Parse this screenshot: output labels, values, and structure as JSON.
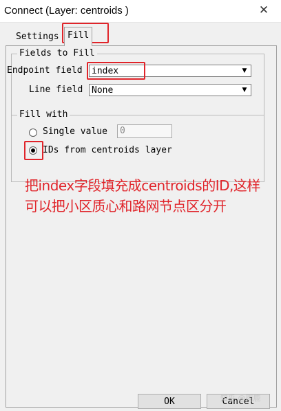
{
  "window": {
    "title": "Connect (Layer: centroids )",
    "close_glyph": "✕"
  },
  "tabs": [
    {
      "label": "Settings"
    },
    {
      "label": "Fill"
    }
  ],
  "fields_group": {
    "legend": "Fields to Fill",
    "endpoint_label": "Endpoint field",
    "endpoint_value": "index",
    "line_label": "Line field",
    "line_value": "None"
  },
  "fill_group": {
    "legend": "Fill with",
    "single_value_label": "Single value",
    "single_value": "0",
    "ids_label": "IDs from centroids layer"
  },
  "annotation": {
    "text": "把index字段填充成centroids的ID,这样可以把小区质心和路网节点区分开"
  },
  "buttons": {
    "ok": "OK",
    "cancel": "Cancel"
  },
  "watermark": "知乎 @雨鹿",
  "colors": {
    "annotation_red": "#e0242a",
    "dialog_bg": "#f0f0f0"
  }
}
